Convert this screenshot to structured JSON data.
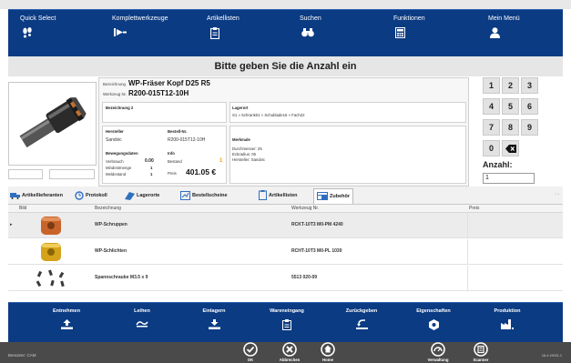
{
  "menu": [
    {
      "label": "Quick Select",
      "icon": "footprints-icon"
    },
    {
      "label": "Komplettwerkzeuge",
      "icon": "tool-assembly-icon"
    },
    {
      "label": "Artikellisten",
      "icon": "clipboard-icon"
    },
    {
      "label": "Suchen",
      "icon": "binoculars-icon"
    },
    {
      "label": "Funktionen",
      "icon": "calculator-icon"
    },
    {
      "label": "Mein Menü",
      "icon": "user-icon"
    }
  ],
  "title": "Bitte geben Sie die Anzahl ein",
  "detail": {
    "bezeichnung_label": "Bezeichnung",
    "bezeichnung": "WP-Fräser Kopf D25 R5",
    "werkzeug_label": "Werkzeug Nr.",
    "werkzeug_nr": "R200-015T12-10H",
    "bezeichnung2_label": "Bezeichnung 2",
    "lagerort_label": "Lagerort",
    "lagerort": "S1 » Schrank01 » Schublade16 » Fach22",
    "hersteller_label": "Hersteller",
    "hersteller": "Sandvic",
    "bestell_label": "Bestell-Nr.",
    "bestell_nr": "R200-015T12-10H",
    "merkmale_label": "Merkmale",
    "merkmale": [
      "Durchmesser: 25",
      "Eckradius: 05",
      "Hersteller: Sandvic"
    ],
    "bewegung_label": "Bewegungsdaten",
    "info_label": "Info",
    "verbrauch_label": "Verbrauch",
    "verbrauch": "0.00",
    "bestand_label": "Bestand",
    "bestand": "1",
    "mindest_label": "Mindestmenge",
    "mindest": "1",
    "melde_label": "Meldestand",
    "melde": "1",
    "preis_label": "Preis",
    "preis": "401.05 €"
  },
  "numpad": {
    "keys": [
      "1",
      "2",
      "3",
      "4",
      "5",
      "6",
      "7",
      "8",
      "9",
      "0"
    ],
    "backspace_icon": "backspace-icon",
    "anzahl_label": "Anzahl:",
    "anzahl_value": "1"
  },
  "tabs": [
    {
      "label": "Artikellieferanten",
      "icon": "truck-icon"
    },
    {
      "label": "Protokoll",
      "icon": "history-icon"
    },
    {
      "label": "Lagerorte",
      "icon": "shelf-icon"
    },
    {
      "label": "Bestellscheine",
      "icon": "order-icon"
    },
    {
      "label": "Artikellisten",
      "icon": "clipboard-icon"
    },
    {
      "label": "Zubehör",
      "icon": "accessories-icon"
    }
  ],
  "grid": {
    "headers": [
      "Bild",
      "Bezeichnung",
      "Werkzeug Nr.",
      "Preis"
    ],
    "rows": [
      {
        "bezeichnung": "WP-Schruppen",
        "werkzeug_nr": "RCKT-10T3 M0-PM 4240",
        "preis": "",
        "image": "insert-orange-image"
      },
      {
        "bezeichnung": "WP-Schlichten",
        "werkzeug_nr": "RCHT-10T3 M0-PL 1030",
        "preis": "",
        "image": "insert-gold-image"
      },
      {
        "bezeichnung": "Spannschraube M3.5 x 9",
        "werkzeug_nr": "5513 020-09",
        "preis": "",
        "image": "screws-image"
      }
    ],
    "selected_marker": "▸"
  },
  "actions": [
    {
      "label": "Entnehmen",
      "icon": "take-out-icon"
    },
    {
      "label": "Leihen",
      "icon": "lend-icon"
    },
    {
      "label": "Einlagern",
      "icon": "store-icon"
    },
    {
      "label": "Wareneingang",
      "icon": "goods-receipt-icon"
    },
    {
      "label": "Zurückgeben",
      "icon": "return-icon"
    },
    {
      "label": "Eigenschaften",
      "icon": "properties-icon"
    },
    {
      "label": "Produktion",
      "icon": "production-icon"
    }
  ],
  "status": {
    "user": "Benutzer: CAM",
    "buttons": [
      {
        "label": "OK",
        "icon": "check-circle-icon"
      },
      {
        "label": "Abbrechen",
        "icon": "x-circle-icon"
      },
      {
        "label": "Home",
        "icon": "home-icon"
      },
      {
        "label": "Verwaltung",
        "icon": "gauge-icon"
      },
      {
        "label": "Scanner",
        "icon": "scanner-icon"
      }
    ],
    "version": "18.4.19001.1"
  },
  "colors": {
    "nav_blue": "#0b3b83",
    "status_gray": "#4a4a4a",
    "bestand_orange": "#f0a000"
  }
}
